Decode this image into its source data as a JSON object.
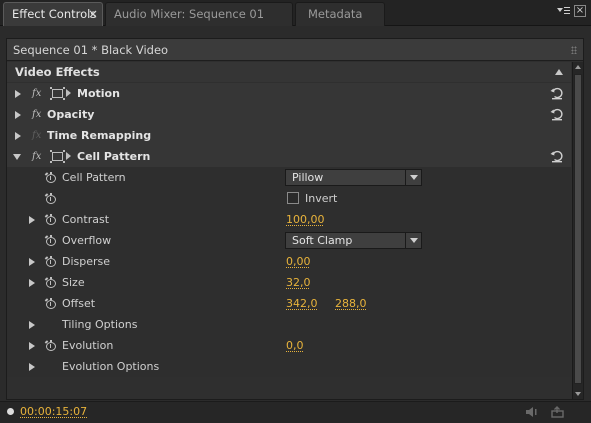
{
  "tabs": [
    {
      "label": "Effect Controls",
      "close": "×",
      "active": true
    },
    {
      "label": "Audio Mixer: Sequence 01",
      "active": false
    },
    {
      "label": "Metadata",
      "active": false
    }
  ],
  "sequence_title": "Sequence 01 * Black Video",
  "section_title": "Video Effects",
  "effects": {
    "motion": "Motion",
    "opacity": "Opacity",
    "time_remapping": "Time Remapping",
    "cell_pattern": "Cell Pattern"
  },
  "fx_label": "fx",
  "props": {
    "cell_pattern": {
      "label": "Cell Pattern",
      "value": "Pillow"
    },
    "invert": {
      "label": "Invert",
      "checked": false
    },
    "contrast": {
      "label": "Contrast",
      "value": "100,00"
    },
    "overflow": {
      "label": "Overflow",
      "value": "Soft Clamp"
    },
    "disperse": {
      "label": "Disperse",
      "value": "0,00"
    },
    "size": {
      "label": "Size",
      "value": "32,0"
    },
    "offset": {
      "label": "Offset",
      "x": "342,0",
      "y": "288,0"
    },
    "tiling_options": {
      "label": "Tiling Options"
    },
    "evolution": {
      "label": "Evolution",
      "value": "0,0"
    },
    "evolution_options": {
      "label": "Evolution Options"
    }
  },
  "timecode": "00:00:15:07",
  "colors": {
    "accent": "#e8b33b",
    "background": "#2f2f2f",
    "header": "#3b3b3b"
  },
  "icons": [
    "close-icon",
    "panel-menu-icon",
    "fx-icon",
    "motion-transform-icon",
    "reset-icon",
    "stopwatch-icon",
    "twirl-arrow-icon",
    "dropdown-arrow-icon",
    "scroll-up-icon",
    "scroll-down-icon",
    "audio-icon",
    "export-icon"
  ]
}
